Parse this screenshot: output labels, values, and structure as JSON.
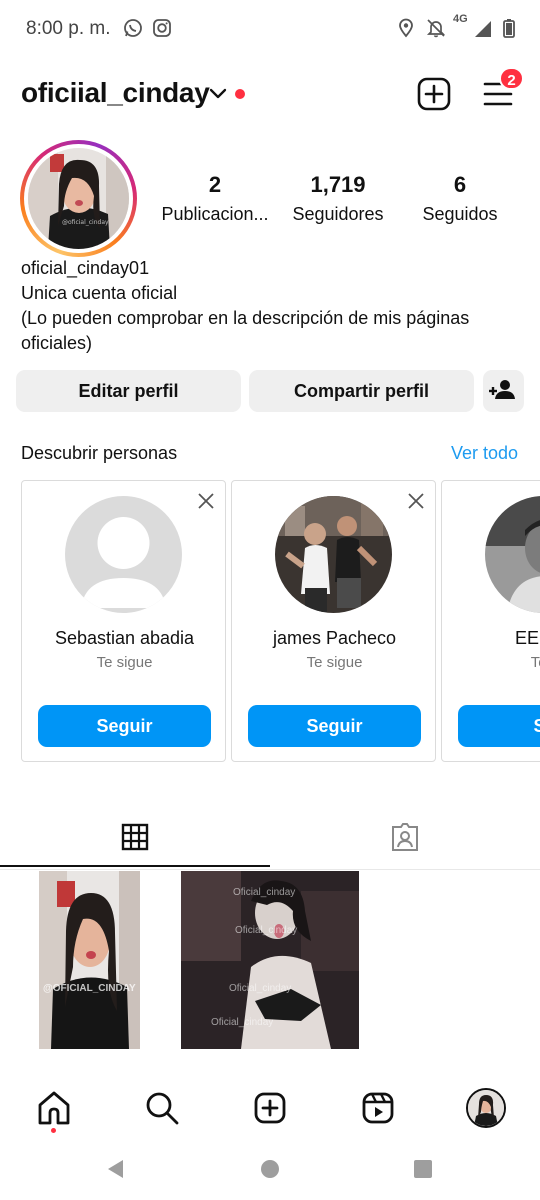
{
  "status_bar": {
    "time": "8:00 p. m.",
    "network": "4G",
    "icons": [
      "whatsapp-icon",
      "instagram-icon",
      "location-icon",
      "mute-icon",
      "signal-icon",
      "battery-icon"
    ]
  },
  "header": {
    "username": "oficiial_cinday",
    "notification_badge": "2",
    "icons": [
      "chevron-down-icon",
      "create-post-icon",
      "menu-icon"
    ]
  },
  "profile": {
    "stats": [
      {
        "value": "2",
        "label": "Publicacion..."
      },
      {
        "value": "1,719",
        "label": "Seguidores"
      },
      {
        "value": "6",
        "label": "Seguidos"
      }
    ],
    "name": "oficial_cinday01",
    "bio_lines": [
      "Unica cuenta oficial",
      "(Lo pueden comprobar en la descripción de mis páginas",
      "oficiales)"
    ]
  },
  "actions": {
    "edit_label": "Editar perfil",
    "share_label": "Compartir perfil"
  },
  "discover": {
    "title": "Descubrir personas",
    "see_all": "Ver todo",
    "cards": [
      {
        "name": "Sebastian abadia",
        "subtitle": "Te sigue",
        "button": "Seguir"
      },
      {
        "name": "james Pacheco",
        "subtitle": "Te sigue",
        "button": "Seguir"
      },
      {
        "name": "EEl RR",
        "subtitle": "Te s",
        "button": "Se"
      }
    ]
  },
  "posts": {
    "watermark_1": "@OFICIAL_CINDAY",
    "watermark_2": "Oficial_cinday"
  },
  "colors": {
    "accent_blue": "#0095f6",
    "link_blue": "#1d9bf0",
    "notification_red": "#ff3040",
    "button_gray": "#efefef"
  }
}
